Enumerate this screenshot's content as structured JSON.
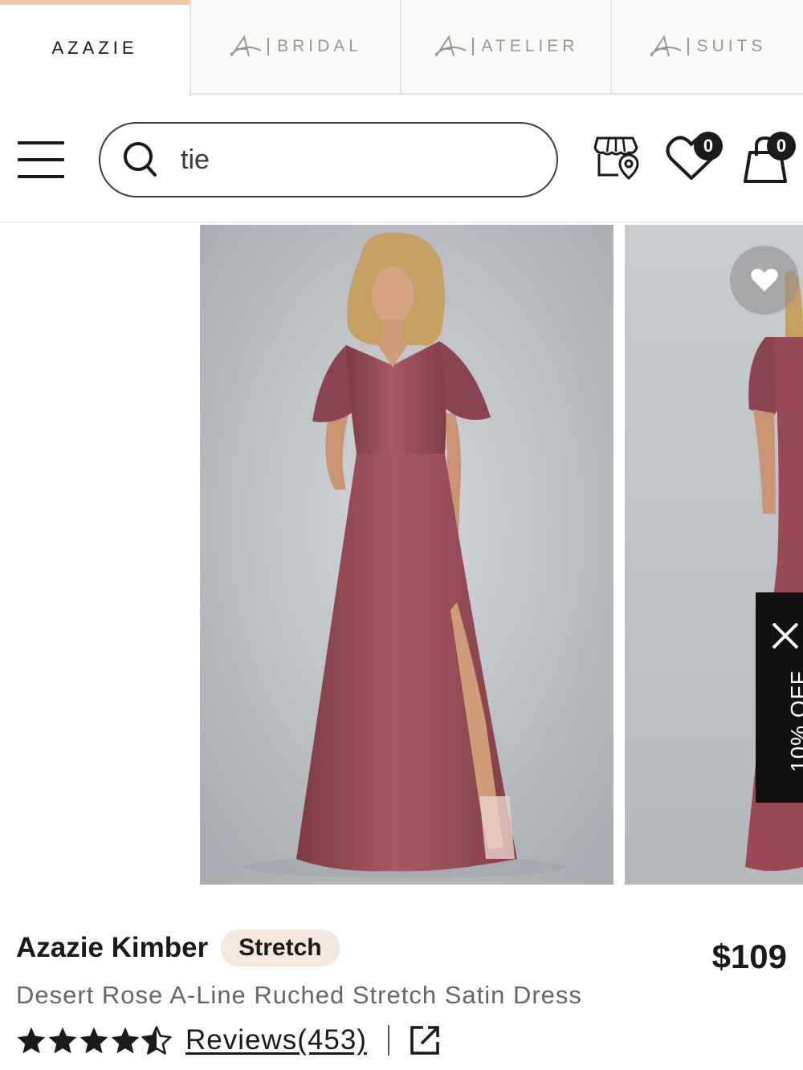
{
  "brand_tabs": [
    {
      "label": "AZAZIE",
      "active": true
    },
    {
      "label": "BRIDAL",
      "active": false
    },
    {
      "label": "ATELIER",
      "active": false
    },
    {
      "label": "SUITS",
      "active": false
    }
  ],
  "header": {
    "search_value": "tie",
    "wishlist_count": "0",
    "cart_count": "0",
    "icons": [
      "menu-icon",
      "search-icon",
      "store-locator-icon",
      "heart-icon",
      "shopping-bag-icon"
    ]
  },
  "promo": {
    "label": "10% OFF"
  },
  "product": {
    "name": "Azazie Kimber",
    "badge": "Stretch",
    "price": "$109",
    "description": "Desert Rose A-Line Ruched Stretch Satin Dress",
    "rating": 4.5,
    "reviews_label": "Reviews(453)"
  },
  "colors": {
    "accent_tab": "#f2c7a9",
    "badge_bg": "#f4e8de",
    "dress": "#9b4a55",
    "promo_bg": "#111111"
  }
}
